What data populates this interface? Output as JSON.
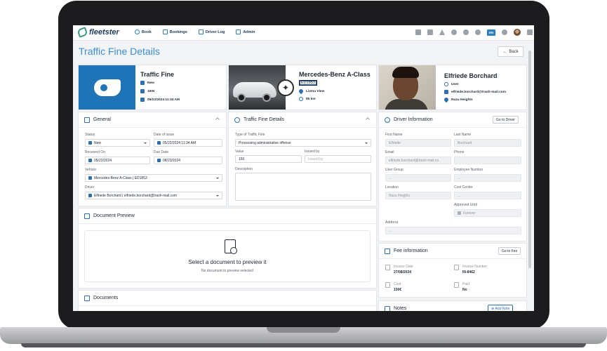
{
  "topbar": {
    "logo_text": "fleetster",
    "nav": [
      {
        "label": "Book",
        "icon": "plus-circle-icon"
      },
      {
        "label": "Bookings",
        "icon": "car-icon"
      },
      {
        "label": "Driver Log",
        "icon": "logbook-icon"
      },
      {
        "label": "Admin",
        "icon": "tools-icon"
      }
    ],
    "language": "EN"
  },
  "page": {
    "title": "Traffic Fine Details",
    "back_label": "Back"
  },
  "hero_fine": {
    "title": "Traffic Fine",
    "status": "New",
    "amount": "150€",
    "datetime": "05/22/2024 11:34 AM"
  },
  "hero_vehicle": {
    "title": "Mercedes-Benz A-Class",
    "plate": "ED1853",
    "location": "Livmu View",
    "mileage": "85 km"
  },
  "hero_driver": {
    "name": "Elfriede Borchard",
    "role": "User",
    "email": "elfriede.borchard@trash-mail.com",
    "location": "Nuzu Heights"
  },
  "general": {
    "title": "General",
    "status_label": "Status",
    "status_value": "New",
    "date_of_issue_label": "Date of issue",
    "date_of_issue_value": "05/22/2024 11:34 AM",
    "received_on_label": "Received On",
    "received_on_value": "05/22/2024",
    "due_date_label": "Due Date",
    "due_date_value": "08/23/2024",
    "vehicle_label": "Vehicle",
    "vehicle_value": "Mercedes-Benz A-Class | ED1853",
    "driver_label": "Driver",
    "driver_value": "Elfriede Borchard | elfriede.borchard@trash-mail.com"
  },
  "fine_details": {
    "title": "Traffic Fine Details",
    "type_label": "Type of Traffic Fine",
    "type_value": "Processing administrative offense",
    "value_label": "Value",
    "value_value": "150",
    "issued_by_label": "Issued by",
    "issued_by_placeholder": "Issued by",
    "description_label": "Description"
  },
  "driver_info": {
    "title": "Driver Information",
    "go_button": "Go to Driver",
    "first_name_label": "First Name",
    "first_name_value": "Elfriede",
    "last_name_label": "Last Name",
    "last_name_value": "Borchard",
    "email_label": "Email",
    "email_value": "elfriede.borchard@trash-mail.co",
    "phone_label": "Phone",
    "phone_value": "",
    "user_group_label": "User Group",
    "user_group_value": "...",
    "employee_number_label": "Employee Number",
    "employee_number_value": "...",
    "location_label": "Location",
    "location_value": "Nuzu Heights",
    "cost_center_label": "Cost Center",
    "cost_center_value": "...",
    "approved_until_label": "Approved Until",
    "approved_until_value": "Forever",
    "address_label": "Address",
    "address_value": "..."
  },
  "document_preview": {
    "title": "Document Preview",
    "heading": "Select a document to preview it",
    "subtext": "No document to preview selected"
  },
  "documents": {
    "title": "Documents"
  },
  "fee_info": {
    "title": "Fee information",
    "go_button": "Go to Fee",
    "invoice_date_label": "Invoice Date",
    "invoice_date_value": "27/08/2024",
    "invoice_number_label": "Invoice Number",
    "invoice_number_value": "IN-8462",
    "cost_label": "Cost",
    "cost_value": "150€",
    "paid_label": "Paid",
    "paid_value": "No"
  },
  "notes": {
    "title": "Notes",
    "add_button": "Add Note"
  },
  "colors": {
    "accent": "#2d6fb0",
    "title_blue": "#3b8fd0",
    "hero_blue": "#1f74b8"
  }
}
